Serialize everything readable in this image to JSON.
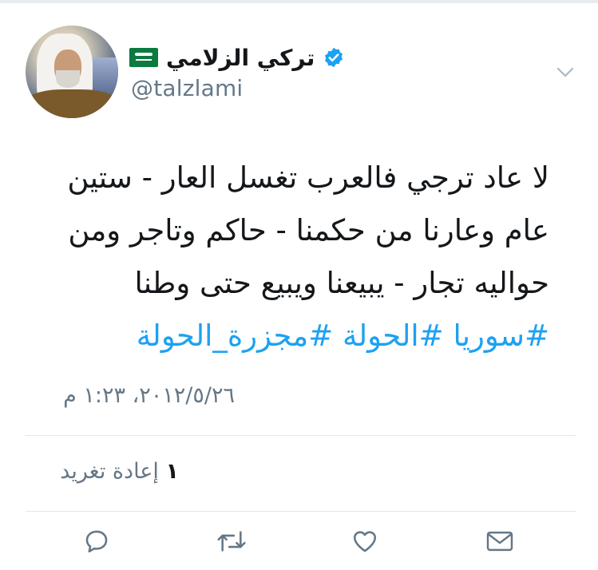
{
  "user": {
    "display_name": "تركي الزلامي",
    "handle": "@talzlami"
  },
  "tweet": {
    "lines": [
      "لا عاد ترجي فالعرب تغسل العار - ستين",
      "عام وعارنا من حكمنا - حاكم وتاجر ومن",
      "حواليه تجار - يبيعنا ويبيع حتى وطنا"
    ],
    "hashtags": "#سوريا #الحولة #مجزرة_الحولة",
    "timestamp": "٢٠١٢/٥/٢٦، ١:٢٣ م"
  },
  "stats": {
    "retweet_count": "١",
    "retweet_label": "إعادة تغريد"
  },
  "icons": {
    "verified": "verified-badge-icon",
    "flag": "saudi-flag-icon",
    "menu": "chevron-down-icon",
    "reply": "reply-icon",
    "retweet": "retweet-icon",
    "like": "heart-icon",
    "dm": "envelope-icon"
  },
  "colors": {
    "accent": "#1da1f2",
    "muted": "#657786",
    "text": "#14171a",
    "divider": "#e1e8ed"
  }
}
